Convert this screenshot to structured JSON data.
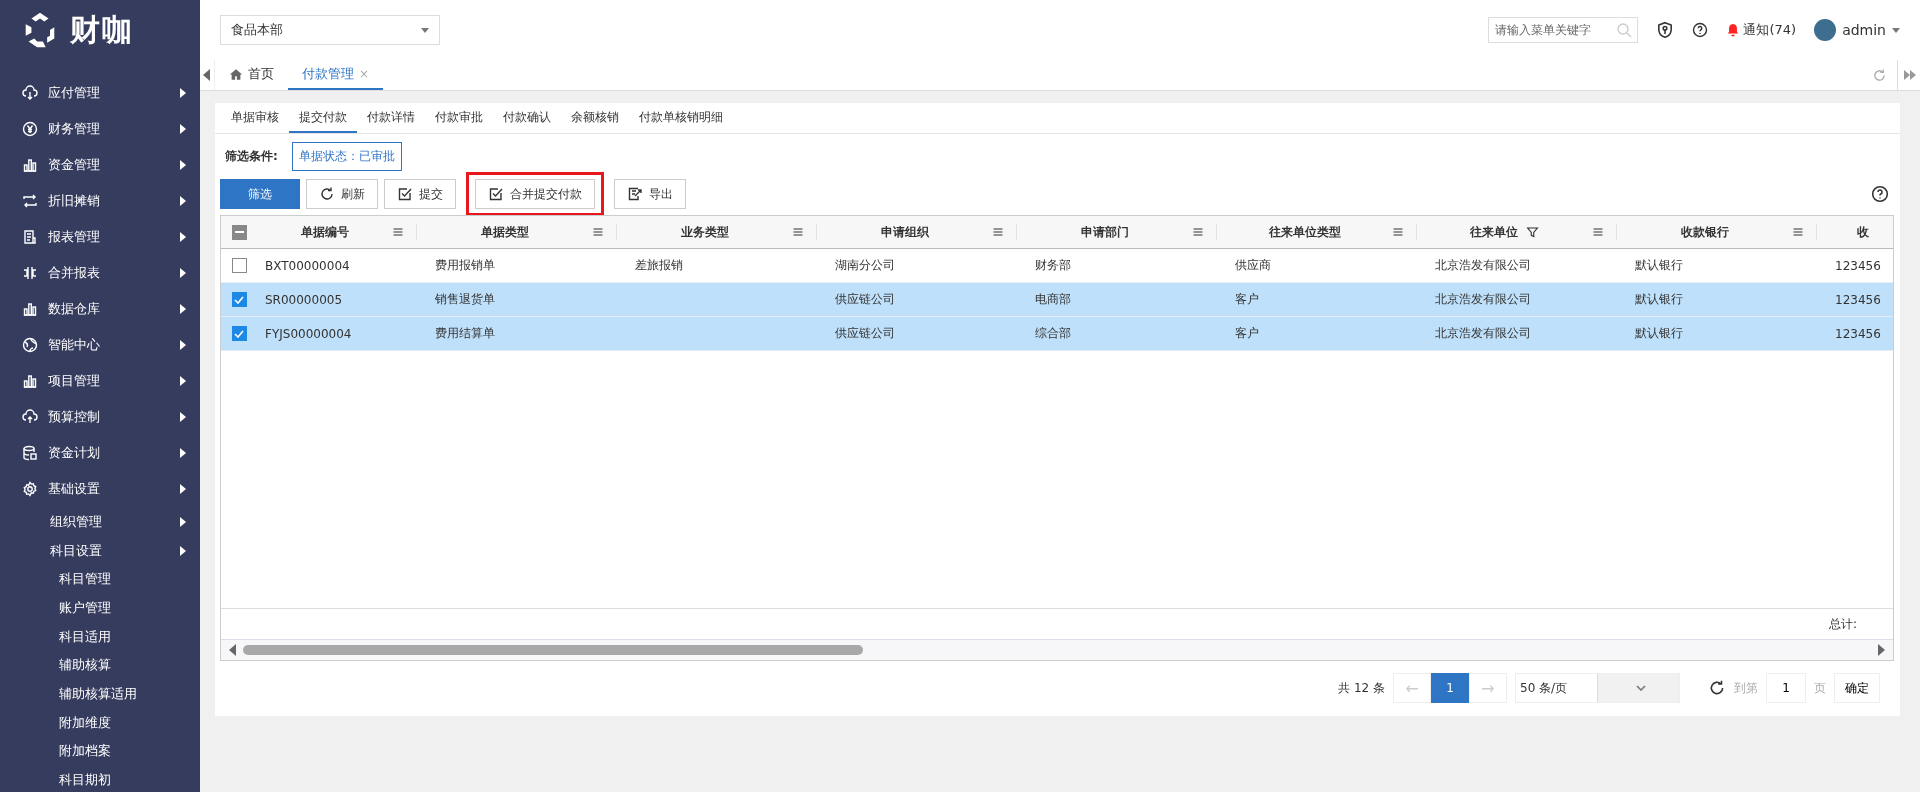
{
  "logo": {
    "text": "财咖"
  },
  "sidebar": {
    "items": [
      {
        "label": "应付管理",
        "has_submenu": true
      },
      {
        "label": "财务管理",
        "has_submenu": true
      },
      {
        "label": "资金管理",
        "has_submenu": true
      },
      {
        "label": "折旧摊销",
        "has_submenu": true
      },
      {
        "label": "报表管理",
        "has_submenu": true
      },
      {
        "label": "合并报表",
        "has_submenu": true
      },
      {
        "label": "数据仓库",
        "has_submenu": true
      },
      {
        "label": "智能中心",
        "has_submenu": true
      },
      {
        "label": "项目管理",
        "has_submenu": true
      },
      {
        "label": "预算控制",
        "has_submenu": true
      },
      {
        "label": "资金计划",
        "has_submenu": true
      },
      {
        "label": "基础设置",
        "has_submenu": true,
        "children": [
          {
            "label": "组织管理",
            "has_submenu": true
          },
          {
            "label": "科目设置",
            "has_submenu": true,
            "children": [
              {
                "label": "科目管理",
                "has_submenu": false
              },
              {
                "label": "账户管理",
                "has_submenu": false
              },
              {
                "label": "科目适用",
                "has_submenu": false
              },
              {
                "label": "辅助核算",
                "has_submenu": false
              },
              {
                "label": "辅助核算适用",
                "has_submenu": false
              },
              {
                "label": "附加维度",
                "has_submenu": false
              },
              {
                "label": "附加档案",
                "has_submenu": false
              },
              {
                "label": "科目期初",
                "has_submenu": false
              }
            ]
          }
        ]
      }
    ]
  },
  "header": {
    "org_select": {
      "value": "食品本部"
    },
    "search": {
      "placeholder": "请输入菜单关键字"
    },
    "notifications": "通知(74)",
    "user": "admin"
  },
  "page_tabs": [
    {
      "label": "首页",
      "selected": false,
      "closable": false
    },
    {
      "label": "付款管理",
      "selected": true,
      "closable": true,
      "close": "×"
    }
  ],
  "sub_tabs": [
    {
      "label": "单据审核",
      "selected": false
    },
    {
      "label": "提交付款",
      "selected": true
    },
    {
      "label": "付款详情",
      "selected": false
    },
    {
      "label": "付款审批",
      "selected": false
    },
    {
      "label": "付款确认",
      "selected": false
    },
    {
      "label": "余额核销",
      "selected": false
    },
    {
      "label": "付款单核销明细",
      "selected": false
    }
  ],
  "filter": {
    "label": "筛选条件:",
    "chips": [
      "单据状态：已审批"
    ]
  },
  "toolbar": [
    {
      "label": "筛选",
      "kind": "primary",
      "highlighted": false
    },
    {
      "label": "刷新",
      "kind": "refresh",
      "highlighted": false
    },
    {
      "label": "提交",
      "kind": "check",
      "highlighted": false
    },
    {
      "label": "合并提交付款",
      "kind": "check",
      "highlighted": true
    },
    {
      "label": "导出",
      "kind": "export",
      "highlighted": false
    }
  ],
  "table": {
    "select_all_indeterminate": true,
    "columns": [
      {
        "label": "单据编号",
        "filter": false
      },
      {
        "label": "单据类型",
        "filter": false
      },
      {
        "label": "业务类型",
        "filter": false
      },
      {
        "label": "申请组织",
        "filter": false
      },
      {
        "label": "申请部门",
        "filter": false
      },
      {
        "label": "往来单位类型",
        "filter": false
      },
      {
        "label": "往来单位",
        "filter": true
      },
      {
        "label": "收款银行",
        "filter": false
      },
      {
        "label": "收",
        "filter": false
      }
    ],
    "rows": [
      {
        "checked": false,
        "cells": [
          "BXT00000004",
          "费用报销单",
          "差旅报销",
          "湖南分公司",
          "财务部",
          "供应商",
          "北京浩发有限公司",
          "默认银行",
          "123456"
        ]
      },
      {
        "checked": true,
        "cells": [
          "SR00000005",
          "销售退货单",
          "",
          "供应链公司",
          "电商部",
          "客户",
          "北京浩发有限公司",
          "默认银行",
          "123456"
        ]
      },
      {
        "checked": true,
        "cells": [
          "FYJS00000004",
          "费用结算单",
          "",
          "供应链公司",
          "综合部",
          "客户",
          "北京浩发有限公司",
          "默认银行",
          "123456"
        ]
      }
    ],
    "total_label": "总计:"
  },
  "pagination": {
    "total": "共 12 条",
    "prev": "←",
    "next": "→",
    "pages": [
      {
        "label": "1",
        "selected": true
      }
    ],
    "page_size": "50 条/页",
    "goto_label": "到第",
    "goto_value": "1",
    "page_unit": "页",
    "confirm": "确定"
  }
}
